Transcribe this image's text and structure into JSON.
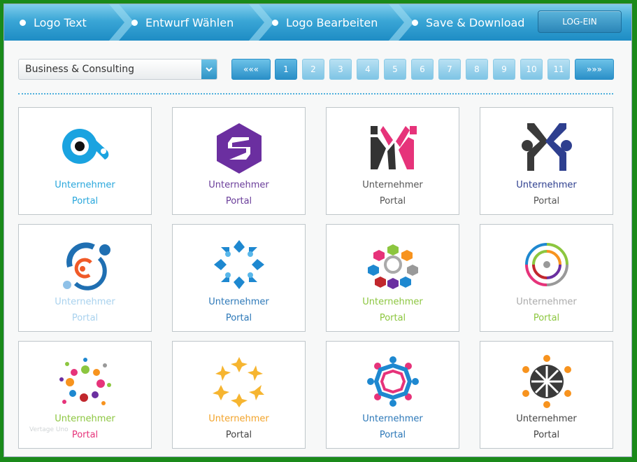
{
  "header": {
    "steps": [
      "Logo Text",
      "Entwurf Wählen",
      "Logo Bearbeiten",
      "Save & Download"
    ],
    "login_label": "LOG-EIN"
  },
  "toolbar": {
    "category": "Business & Consulting",
    "pages": [
      "1",
      "2",
      "3",
      "4",
      "5",
      "6",
      "7",
      "8",
      "9",
      "10",
      "11"
    ],
    "active_page": "1",
    "prev_label": "«««",
    "next_label": "»»»"
  },
  "cards": [
    {
      "icon": "eye-swirl-icon",
      "line1": "Unternehmer",
      "line2": "Portal",
      "color1": "#29a7dc",
      "color2": "#29a7dc"
    },
    {
      "icon": "hexagon-s-icon",
      "line1": "Unternehmer",
      "line2": "Portal",
      "color1": "#6a3d9a",
      "color2": "#6a3d9a"
    },
    {
      "icon": "km-monogram-icon",
      "line1": "Unternehmer",
      "line2": "Portal",
      "color1": "#555555",
      "color2": "#555555"
    },
    {
      "icon": "people-m-icon",
      "line1": "Unternehmer",
      "line2": "Portal",
      "color1": "#2e3f8f",
      "color2": "#555555"
    },
    {
      "icon": "orbit-people-icon",
      "line1": "Unternehmer",
      "line2": "Portal",
      "color1": "#a9d2ee",
      "color2": "#a9d2ee"
    },
    {
      "icon": "blue-people-ring-icon",
      "line1": "Unternehmer",
      "line2": "Portal",
      "color1": "#2c78b8",
      "color2": "#2c78b8"
    },
    {
      "icon": "hexagon-people-ring-icon",
      "line1": "Unternehmer",
      "line2": "Portal",
      "color1": "#8cc63f",
      "color2": "#8cc63f"
    },
    {
      "icon": "radial-arcs-icon",
      "line1": "Unternehmer",
      "line2": "Portal",
      "color1": "#aaaaaa",
      "color2": "#8cc63f"
    },
    {
      "icon": "dotted-burst-icon",
      "line1": "Unternehmer",
      "line2": "Portal",
      "color1": "#8cc63f",
      "color2": "#e6337a"
    },
    {
      "icon": "yellow-people-ring-icon",
      "line1": "Unternehmer",
      "line2": "Portal",
      "color1": "#f2a32a",
      "color2": "#444444"
    },
    {
      "icon": "pink-blue-people-ring-icon",
      "line1": "Unternehmer",
      "line2": "Portal",
      "color1": "#2c78b8",
      "color2": "#2c78b8"
    },
    {
      "icon": "orange-team-circle-icon",
      "line1": "Unternehmer",
      "line2": "Portal",
      "color1": "#444444",
      "color2": "#444444"
    }
  ],
  "watermark": "Vertage Uno"
}
